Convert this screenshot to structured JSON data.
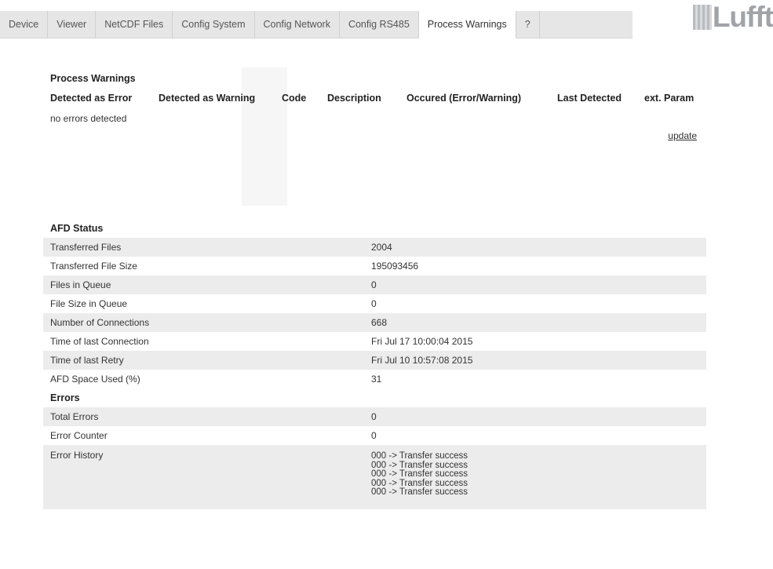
{
  "tabs": [
    {
      "label": "Device",
      "active": false
    },
    {
      "label": "Viewer",
      "active": false
    },
    {
      "label": "NetCDF Files",
      "active": false
    },
    {
      "label": "Config System",
      "active": false
    },
    {
      "label": "Config Network",
      "active": false
    },
    {
      "label": "Config RS485",
      "active": false
    },
    {
      "label": "Process Warnings",
      "active": true
    },
    {
      "label": "?",
      "active": false
    }
  ],
  "logo": {
    "text": "Lufft"
  },
  "process_warnings": {
    "title": "Process Warnings",
    "columns": [
      "Detected as Error",
      "Detected as Warning",
      "Code",
      "Description",
      "Occured (Error/Warning)",
      "Last Detected",
      "ext. Param"
    ],
    "status": "no errors detected",
    "update_label": "update"
  },
  "afd": {
    "title": "AFD Status",
    "rows": [
      {
        "label": "Transferred Files",
        "value": "2004"
      },
      {
        "label": "Transferred File Size",
        "value": "195093456"
      },
      {
        "label": "Files in Queue",
        "value": "0"
      },
      {
        "label": "File Size in Queue",
        "value": "0"
      },
      {
        "label": "Number of Connections",
        "value": "668"
      },
      {
        "label": "Time of last Connection",
        "value": "Fri Jul 17 10:00:04 2015"
      },
      {
        "label": "Time of last Retry",
        "value": "Fri Jul 10 10:57:08 2015"
      },
      {
        "label": "AFD Space Used (%)",
        "value": "31"
      }
    ],
    "errors_title": "Errors",
    "error_rows": [
      {
        "label": "Total Errors",
        "value": "0"
      },
      {
        "label": "Error Counter",
        "value": "0"
      }
    ],
    "history_label": "Error History",
    "history": [
      "000 -> Transfer success",
      "000 -> Transfer success",
      "000 -> Transfer success",
      "000 -> Transfer success",
      "000 -> Transfer success"
    ]
  },
  "colors": {
    "tab_background": "#e6e6e6",
    "row_shade": "#ececec",
    "logo": "#a0a4a8"
  }
}
